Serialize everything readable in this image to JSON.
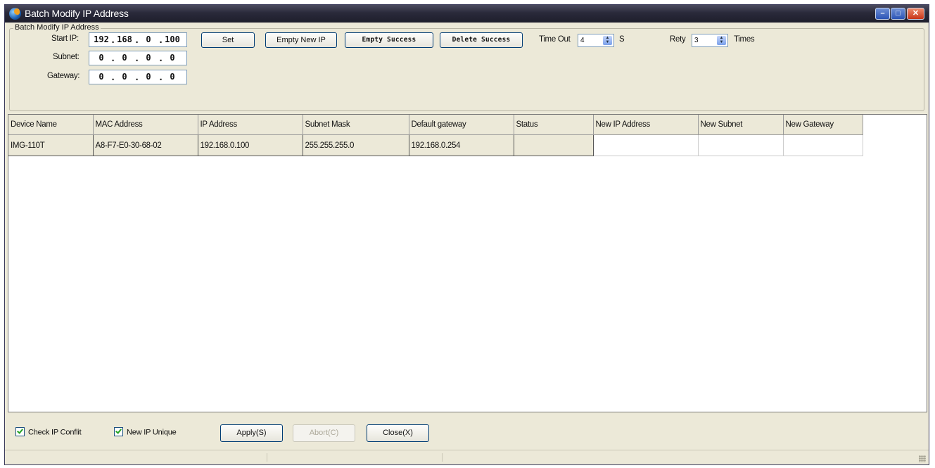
{
  "window": {
    "title": "Batch Modify IP Address"
  },
  "group": {
    "legend": "Batch Modify IP Address",
    "start_ip_label": "Start IP:",
    "start_ip": [
      "192",
      "168",
      "0",
      "100"
    ],
    "subnet_label": "Subnet:",
    "subnet": [
      "0",
      "0",
      "0",
      "0"
    ],
    "gateway_label": "Gateway:",
    "gateway": [
      "0",
      "0",
      "0",
      "0"
    ],
    "buttons": {
      "set": "Set",
      "empty_new_ip": "Empty New IP",
      "empty_success": "Empty Success",
      "delete_success": "Delete Success"
    },
    "timeout_label": "Time Out",
    "timeout_value": "4",
    "timeout_unit": "S",
    "retry_label": "Rety",
    "retry_value": "3",
    "retry_unit": "Times"
  },
  "table": {
    "columns": [
      "Device Name",
      "MAC Address",
      "IP Address",
      "Subnet Mask",
      "Default gateway",
      "Status",
      "New IP Address",
      "New Subnet",
      "New Gateway"
    ],
    "rows": [
      [
        "IMG-110T",
        "A8-F7-E0-30-68-02",
        "192.168.0.100",
        "255.255.255.0",
        "192.168.0.254",
        "",
        "",
        "",
        ""
      ]
    ]
  },
  "footer": {
    "check_ip_conflict": "Check IP Conflit",
    "new_ip_unique": "New IP Unique",
    "apply": "Apply(S)",
    "abort": "Abort(C)",
    "close": "Close(X)"
  }
}
